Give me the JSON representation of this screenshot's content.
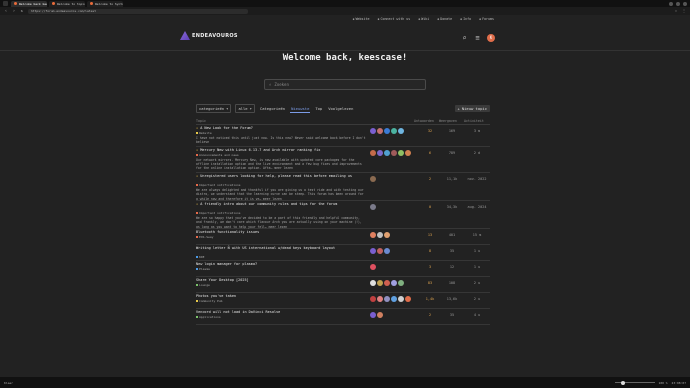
{
  "browser": {
    "tabs": [
      {
        "label": "Welcome back keesca",
        "active": true
      },
      {
        "label": "Welcome to topics",
        "active": false
      },
      {
        "label": "Welcome to Syntonova",
        "active": false
      }
    ],
    "url": "https://forum.endeavouros.com/latest"
  },
  "site": {
    "header_links": [
      "Website",
      "Connect with us",
      "Wiki",
      "Donate",
      "Info",
      "Forums"
    ],
    "logo_text": "ENDEAVOUROS",
    "avatar_letter": "K"
  },
  "welcome": "Welcome back, keescase!",
  "search": {
    "placeholder": "Zoeken"
  },
  "filters": {
    "categories_label": "categorieën",
    "tags_label": "alle",
    "tabs": [
      "Categorieën",
      "Nieuwste",
      "Top",
      "Voolgelezen"
    ],
    "active_tab": 1,
    "new_topic": "Nieuw topic"
  },
  "table_header": {
    "topic": "Topic",
    "replies": "Antwoorden",
    "views": "Weergaven",
    "activity": "Activiteit"
  },
  "topics": [
    {
      "title": "A New Look for the Forum?",
      "pinned": true,
      "category": "Website",
      "category_color": "#e6c84a",
      "excerpt": "I have not noticed this until just now. Is this new? Never said welcome back before I don't believe",
      "avatars": [
        "#7a5fd0",
        "#c47070",
        "#3a7bd5",
        "#4bb3a0",
        "#6fb5e0"
      ],
      "replies": "32",
      "views": "169",
      "activity": "3 m"
    },
    {
      "title": "Mercury New with Linux 6.13.7 and Arch mirror ranking fix",
      "pinned": true,
      "category": "Announcements and news",
      "category_color": "#e66a4a",
      "excerpt": "Our network mirrors. Mercury New, is now available with updated core packages for the offline installation option and the live environment and a few bug fixes and improvements for the online installation option. Afte… meer lezen",
      "avatars": [
        "#c46b4a",
        "#7d68c9",
        "#50a0d0",
        "#a05a5a",
        "#8fbf63",
        "#d08050"
      ],
      "replies": "6",
      "views": "789",
      "activity": "2 d"
    },
    {
      "title": "Unregistered users looking for help, please read this before emailing us",
      "pinned": true,
      "category": "Important notifications",
      "category_color": "#e66a4a",
      "excerpt": "We are always delighted and thankful if you are giving us a test ride and with testing our distro, we understand that the learning curve can be steep. This forum has been around for a while now and therefore it is ve… meer lezen",
      "avatars": [
        "#8a6a50"
      ],
      "replies": "2",
      "views": "11,1k",
      "activity": "nov. 2022"
    },
    {
      "title": "A friendly intro about our community rules and tips for the forum",
      "pinned": true,
      "category": "Important notifications",
      "category_color": "#e66a4a",
      "excerpt": "We are so happy that you've decided to be a part of this friendly and helpful community, and frankly, we don't care which flavour Arch you are actually using on your machine (!), as long as you want to help your fell… meer lezen",
      "avatars": [
        "#7a7a8a"
      ],
      "replies": "0",
      "views": "34,3k",
      "activity": "aug. 2024"
    },
    {
      "title": "Bluetooth functionality issues",
      "pinned": false,
      "category": "EOS-Sway",
      "category_color": "#e66a4a",
      "excerpt": "",
      "avatars": [
        "#e08060",
        "#c0c0c0",
        "#e0a070"
      ],
      "replies": "13",
      "views": "401",
      "activity": "15 m"
    },
    {
      "title": "Writing letter Ñ with US international w/dead keys keyboard layout",
      "pinned": false,
      "category": "KDE",
      "category_color": "#4a9ae6",
      "excerpt": "",
      "avatars": [
        "#7a5fd0",
        "#c06060",
        "#6a8ad0"
      ],
      "replies": "8",
      "views": "35",
      "activity": "1 u"
    },
    {
      "title": "New login manager for plasma?",
      "pinned": false,
      "category": "Plasma",
      "category_color": "#4a9ae6",
      "excerpt": "",
      "avatars": [
        "#e05060"
      ],
      "replies": "3",
      "views": "12",
      "activity": "1 u"
    },
    {
      "title": "Share Your Desktop [2025]",
      "pinned": false,
      "category": "Lounge",
      "category_color": "#7bc36a",
      "excerpt": "",
      "avatars": [
        "#e0e0e0",
        "#c0a050",
        "#d06050",
        "#a0a0e0",
        "#80b080"
      ],
      "replies": "83",
      "views": "108",
      "activity": "2 u"
    },
    {
      "title": "Photos you've taken",
      "pinned": false,
      "category": "Community Pub",
      "category_color": "#e6c84a",
      "excerpt": "",
      "avatars": [
        "#c04040",
        "#e08080",
        "#9090c0",
        "#60a0e0",
        "#d0d0d0",
        "#e06d4a"
      ],
      "replies": "1,4k",
      "views": "13,6k",
      "activity": "2 u"
    },
    {
      "title": "Vencord will not load in DaVinci Resolve",
      "pinned": false,
      "category": "Applications",
      "category_color": "#7bc36a",
      "excerpt": "",
      "avatars": [
        "#7a5fd0",
        "#d08060"
      ],
      "replies": "2",
      "views": "35",
      "activity": "4 u"
    }
  ],
  "status": {
    "left": "Klaar",
    "zoom": "100 %",
    "time": "23:08:07"
  }
}
